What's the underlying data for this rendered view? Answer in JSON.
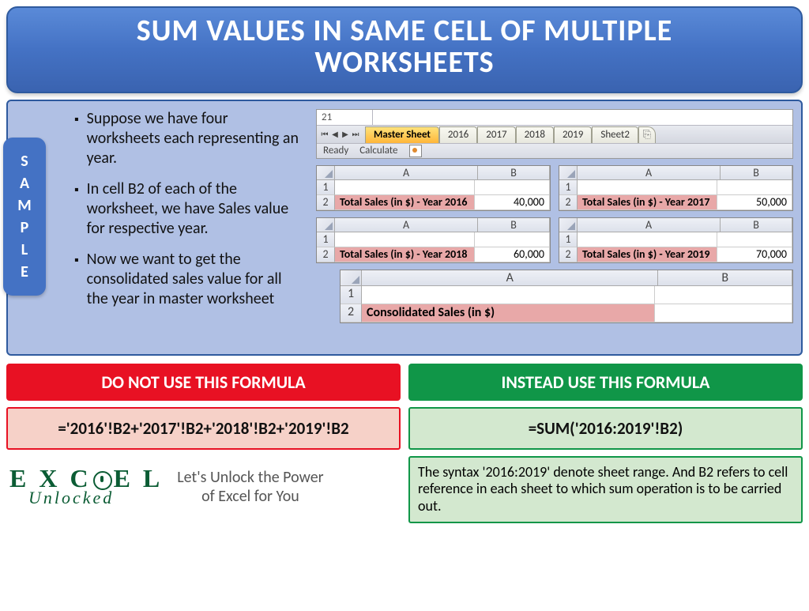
{
  "title_line1": "SUM VALUES IN SAME CELL OF MULTIPLE",
  "title_line2": "WORKSHEETS",
  "sample_badge": [
    "S",
    "A",
    "M",
    "P",
    "L",
    "E"
  ],
  "bullets": [
    "Suppose we have four worksheets each representing an year.",
    "In cell B2 of each of the worksheet, we have Sales value for respective year.",
    "Now we want to get the consolidated sales value for all the year in master worksheet"
  ],
  "name_box": "21",
  "tabs": [
    "Master Sheet",
    "2016",
    "2017",
    "2018",
    "2019",
    "Sheet2"
  ],
  "active_tab_index": 0,
  "status": {
    "ready": "Ready",
    "calc": "Calculate"
  },
  "col_headers": [
    "A",
    "B"
  ],
  "sheets": [
    {
      "label": "Total Sales (in $) - Year 2016",
      "value": "40,000"
    },
    {
      "label": "Total Sales (in $) - Year 2017",
      "value": "50,000"
    },
    {
      "label": "Total Sales (in $) - Year 2018",
      "value": "60,000"
    },
    {
      "label": "Total Sales (in $) - Year 2019",
      "value": "70,000"
    }
  ],
  "master": {
    "label": "Consolidated Sales (in $)",
    "value": ""
  },
  "bad": {
    "header": "DO NOT USE THIS FORMULA",
    "formula": "='2016'!B2+'2017'!B2+'2018'!B2+'2019'!B2"
  },
  "good": {
    "header": "INSTEAD USE THIS FORMULA",
    "formula": "=SUM('2016:2019'!B2)"
  },
  "explain": "The syntax '2016:2019' denote sheet range. And B2 refers to cell reference in each sheet to which sum operation is to be carried out.",
  "brand": {
    "top1": "E X C E L",
    "bottom": "Unlocked"
  },
  "tagline_l1": "Let's Unlock the Power",
  "tagline_l2": "of Excel for You"
}
